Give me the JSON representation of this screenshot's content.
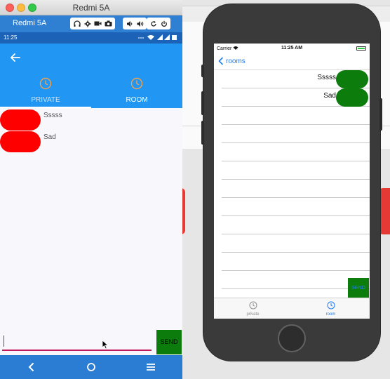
{
  "android": {
    "window_title": "Redmi 5A",
    "device_name": "Redmi 5A",
    "status_time": "11:25",
    "tabs": [
      {
        "label": "PRIVATE",
        "selected": false
      },
      {
        "label": "ROOM",
        "selected": true
      }
    ],
    "messages": [
      "Sssss",
      "Sad"
    ],
    "input": {
      "value": "",
      "placeholder": ""
    },
    "send_label": "SEND",
    "colors": {
      "app_bar": "#2196f3",
      "bubble": "#ff0000",
      "send": "#0c7d0c",
      "tab_icon": "#f4a24c"
    }
  },
  "ios": {
    "carrier": "Carrier",
    "time": "11:25 AM",
    "back_label": "rooms",
    "messages": [
      "Sssss",
      "Sad"
    ],
    "send_label": "SEND",
    "tabs": [
      {
        "label": "private",
        "selected": false
      },
      {
        "label": "room",
        "selected": true
      }
    ],
    "colors": {
      "accent": "#1e7cf0",
      "bubble": "#0c7d0c"
    }
  }
}
